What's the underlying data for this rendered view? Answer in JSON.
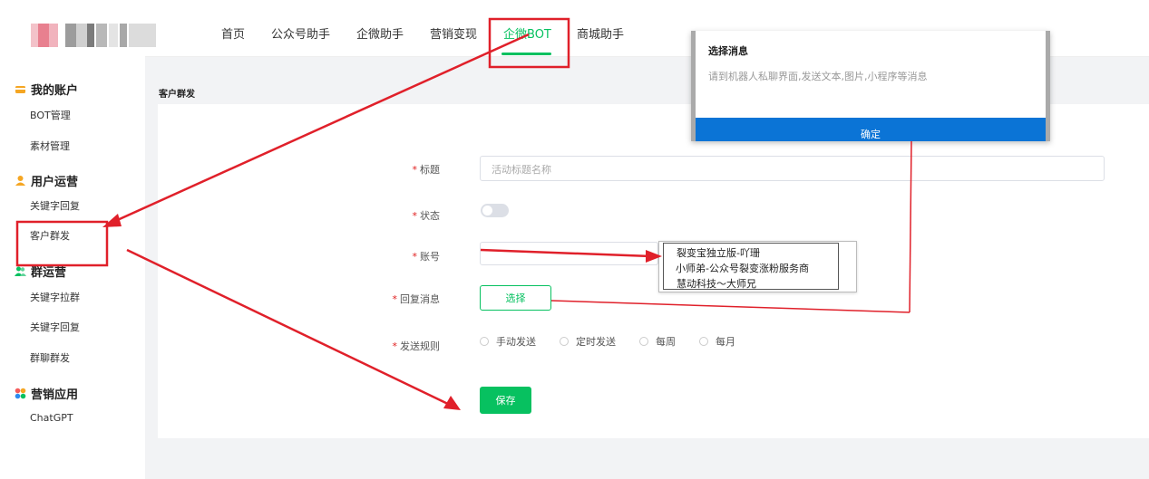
{
  "nav": {
    "items": [
      {
        "label": "首页"
      },
      {
        "label": "公众号助手"
      },
      {
        "label": "企微助手"
      },
      {
        "label": "营销变现"
      },
      {
        "label": "企微BOT"
      },
      {
        "label": "商城助手"
      }
    ],
    "active_index": 4,
    "accent_color": "#07c160"
  },
  "sidebar": {
    "sections": [
      {
        "title": "我的账户",
        "icon": "wallet-icon",
        "items": [
          "BOT管理",
          "素材管理"
        ]
      },
      {
        "title": "用户运营",
        "icon": "user-icon",
        "items": [
          "关键字回复",
          "客户群发"
        ]
      },
      {
        "title": "群运营",
        "icon": "group-icon",
        "items": [
          "关键字拉群",
          "关键字回复",
          "群聊群发"
        ]
      },
      {
        "title": "营销应用",
        "icon": "apps-icon",
        "items": [
          "ChatGPT"
        ]
      }
    ]
  },
  "page": {
    "title": "客户群发"
  },
  "form": {
    "title_label": "标题",
    "title_placeholder": "活动标题名称",
    "status_label": "状态",
    "status_on": false,
    "account_label": "账号",
    "reply_label": "回复消息",
    "select_button": "选择",
    "rule_label": "发送规则",
    "rules": [
      "手动发送",
      "定时发送",
      "每周",
      "每月"
    ],
    "save_button": "保存"
  },
  "account_dropdown": {
    "options": [
      "裂变宝独立版-吖珊",
      "小师弟-公众号裂变涨粉服务商",
      "慧动科技～大师兄"
    ]
  },
  "modal": {
    "title": "选择消息",
    "description": "请到机器人私聊界面,发送文本,图片,小程序等消息",
    "confirm": "确定"
  },
  "annotation_color": "#e0202a"
}
